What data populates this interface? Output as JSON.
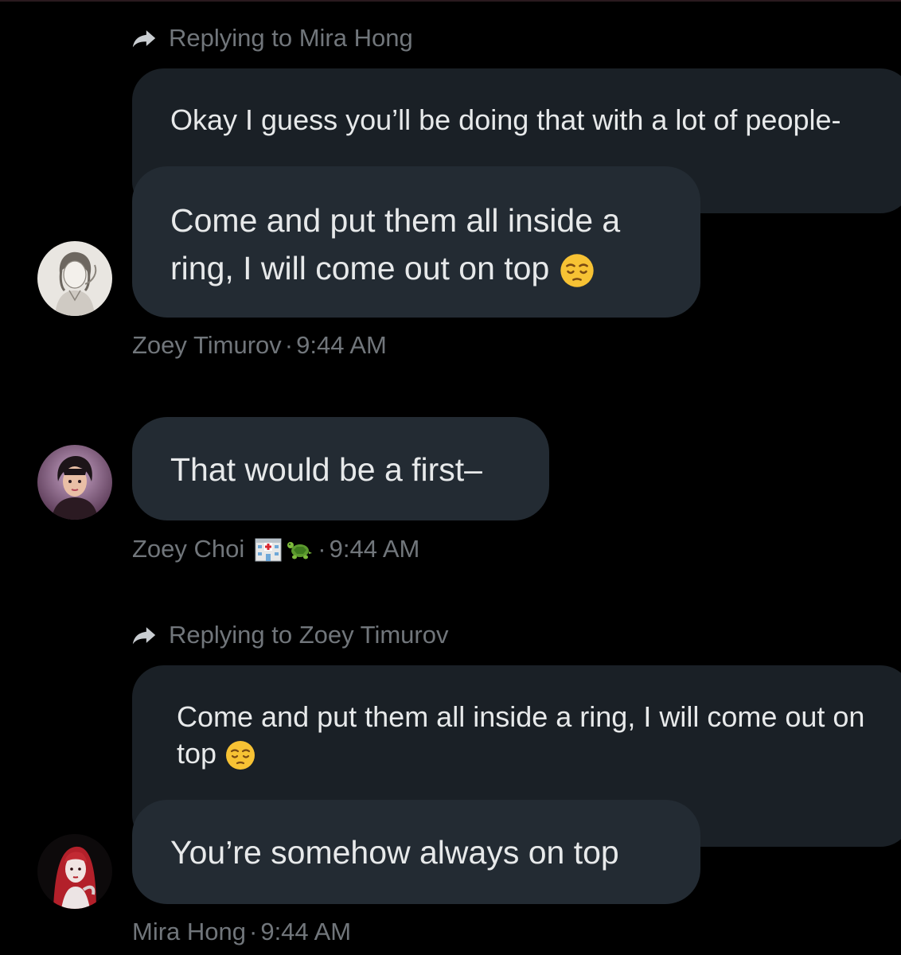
{
  "messages": [
    {
      "reply_label": "Replying to Mira Hong",
      "quoted_text": "Okay I guess you’ll be doing that with a lot of people-",
      "text_line1": "Come and put them all inside a",
      "text_line2": "ring, I will come out on top",
      "author": "Zoey Timurov",
      "separator": "·",
      "time": "9:44 AM"
    },
    {
      "text": "That would be a first–",
      "author": "Zoey Choi",
      "separator": "·",
      "time": "9:44 AM"
    },
    {
      "reply_label": "Replying to Zoey Timurov",
      "quoted_line1": "Come and put them all inside a ring, I will come out on",
      "quoted_line2": "top",
      "text": "You’re somehow always on top",
      "author": "Mira Hong",
      "separator": "·",
      "time": "9:44 AM"
    }
  ],
  "icons": {
    "reply": "reply-arrow-icon",
    "emoji_pensive": "pensive-face-emoji",
    "emoji_hospital": "hospital-emoji",
    "emoji_turtle": "turtle-emoji"
  },
  "colors": {
    "background": "#000000",
    "bubble": "#232b33",
    "quoted_bubble": "#1a2026",
    "text": "#e7e9ea",
    "muted": "#71767b"
  }
}
